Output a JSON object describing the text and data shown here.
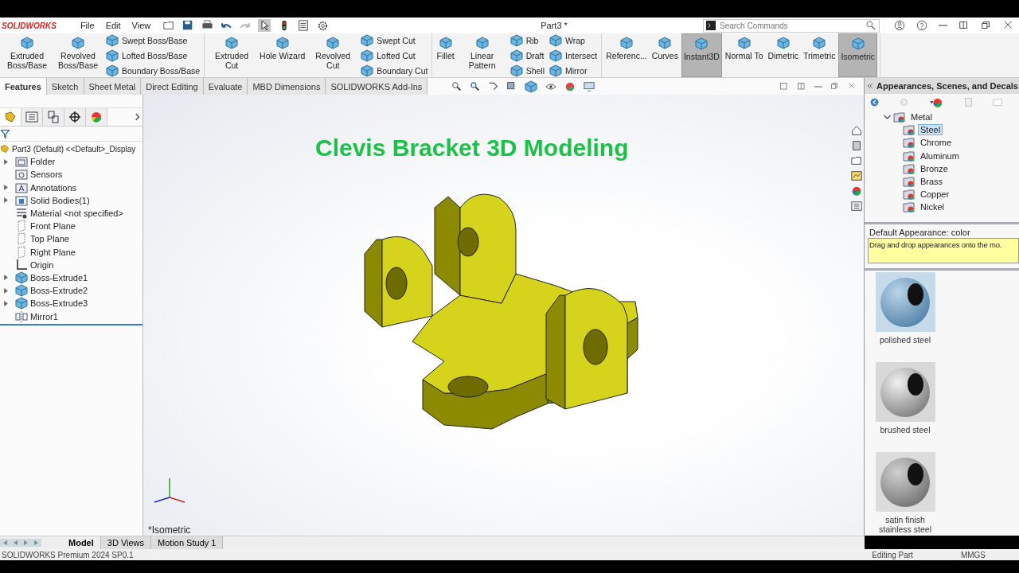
{
  "app": {
    "logo": "SOLIDWORKS",
    "menu": [
      "File",
      "Edit",
      "View"
    ],
    "title": "Part3 *",
    "search": {
      "placeholder": "Search Commands"
    }
  },
  "ribbon": {
    "groups": [
      {
        "columns": [
          {
            "kind": "large",
            "label": "Extruded Boss/Base",
            "selected": false
          },
          {
            "kind": "large",
            "label": "Revolved Boss/Base",
            "selected": false
          },
          {
            "kind": "stack",
            "items": [
              "Swept Boss/Base",
              "Lofted Boss/Base",
              "Boundary Boss/Base"
            ]
          }
        ]
      },
      {
        "columns": [
          {
            "kind": "large",
            "label": "Extruded Cut",
            "selected": false
          },
          {
            "kind": "large",
            "label": "Hole Wizard",
            "selected": false
          },
          {
            "kind": "large",
            "label": "Revolved Cut",
            "selected": false
          },
          {
            "kind": "stack",
            "items": [
              "Swept Cut",
              "Lofted Cut",
              "Boundary Cut"
            ]
          }
        ]
      },
      {
        "columns": [
          {
            "kind": "large",
            "label": "Fillet",
            "selected": false
          },
          {
            "kind": "large",
            "label": "Linear Pattern",
            "selected": false
          },
          {
            "kind": "stack",
            "items": [
              "Rib",
              "Draft",
              "Shell"
            ]
          },
          {
            "kind": "stack",
            "items": [
              "Wrap",
              "Intersect",
              "Mirror"
            ]
          }
        ]
      },
      {
        "columns": [
          {
            "kind": "large",
            "label": "Referenc...",
            "selected": false
          },
          {
            "kind": "large",
            "label": "Curves",
            "selected": false
          },
          {
            "kind": "large",
            "label": "Instant3D",
            "selected": true
          },
          {
            "kind": "large",
            "label": "Normal To",
            "selected": false
          },
          {
            "kind": "large",
            "label": "Dimetric",
            "selected": false
          },
          {
            "kind": "large",
            "label": "Trimetric",
            "selected": false
          },
          {
            "kind": "large",
            "label": "Isometric",
            "selected": true
          }
        ]
      }
    ]
  },
  "command_tabs": [
    {
      "label": "Features",
      "selected": true
    },
    {
      "label": "Sketch",
      "selected": false
    },
    {
      "label": "Sheet Metal",
      "selected": false
    },
    {
      "label": "Direct Editing",
      "selected": false
    },
    {
      "label": "Evaluate",
      "selected": false
    },
    {
      "label": "MBD Dimensions",
      "selected": false
    },
    {
      "label": "SOLIDWORKS Add-Ins",
      "selected": false
    }
  ],
  "feature_tree": {
    "root": "Part3 (Default) <<Default>_Display",
    "items": [
      {
        "label": "Folder",
        "kind": "folder",
        "collapsed": true
      },
      {
        "label": "Sensors",
        "kind": "sensor",
        "collapsed": false
      },
      {
        "label": "Annotations",
        "kind": "annotation",
        "collapsed": true
      },
      {
        "label": "Solid Bodies(1)",
        "kind": "bodies",
        "collapsed": true
      },
      {
        "label": "Material <not specified>",
        "kind": "material",
        "collapsed": false
      },
      {
        "label": "Front Plane",
        "kind": "plane",
        "collapsed": false
      },
      {
        "label": "Top Plane",
        "kind": "plane",
        "collapsed": false
      },
      {
        "label": "Right Plane",
        "kind": "plane",
        "collapsed": false
      },
      {
        "label": "Origin",
        "kind": "origin",
        "collapsed": false
      },
      {
        "label": "Boss-Extrude1",
        "kind": "extrude",
        "collapsed": true
      },
      {
        "label": "Boss-Extrude2",
        "kind": "extrude",
        "collapsed": true
      },
      {
        "label": "Boss-Extrude3",
        "kind": "extrude",
        "collapsed": true
      },
      {
        "label": "Mirror1",
        "kind": "mirror",
        "collapsed": false
      }
    ]
  },
  "viewport": {
    "title": "Clevis Bracket 3D Modeling",
    "view_name": "*Isometric"
  },
  "task_pane": {
    "title": "Appearances, Scenes, and Decals",
    "tree": {
      "label": "Metal",
      "expanded": true,
      "children": [
        {
          "label": "Steel",
          "selected": true
        },
        {
          "label": "Chrome",
          "selected": false
        },
        {
          "label": "Aluminum",
          "selected": false
        },
        {
          "label": "Bronze",
          "selected": false
        },
        {
          "label": "Brass",
          "selected": false
        },
        {
          "label": "Copper",
          "selected": false
        },
        {
          "label": "Nickel",
          "selected": false
        }
      ]
    },
    "default_appearance": "Default Appearance: color",
    "tip": "Drag and drop appearances onto the mo.",
    "swatches": [
      {
        "label": "polished steel",
        "kind": "polished"
      },
      {
        "label": "brushed steel",
        "kind": "brushed"
      },
      {
        "label": "satin finish stainless steel",
        "kind": "satin"
      }
    ]
  },
  "bottom_tabs": [
    {
      "label": "Model",
      "selected": true
    },
    {
      "label": "3D Views",
      "selected": false
    },
    {
      "label": "Motion Study 1",
      "selected": false
    }
  ],
  "status_bar": [
    "SOLIDWORKS Premium 2024 SP0.1",
    "Editing Part",
    "MMGS"
  ]
}
